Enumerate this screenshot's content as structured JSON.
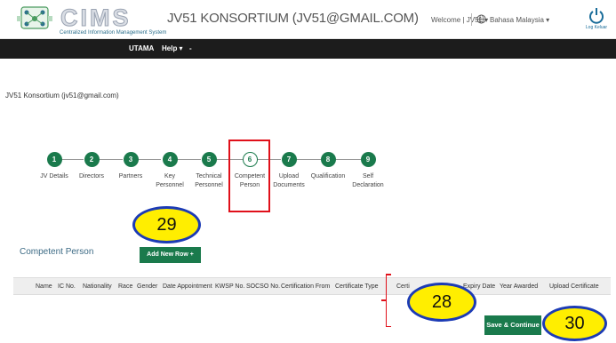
{
  "header": {
    "logo_text": "CIMS",
    "logo_subtitle": "Centralized Information Management System",
    "title": "JV51 KONSORTIUM (JV51@GMAIL.COM)",
    "welcome": "Welcome | JV51 ▾",
    "language": "Bahasa Malaysia ▾",
    "logout_label": "Log Keluar"
  },
  "nav": {
    "items": [
      "UTAMA",
      "Help ▾",
      "-"
    ]
  },
  "company_line": "JV51 Konsortium (jv51@gmail.com)",
  "steps": [
    {
      "number": "1",
      "label": "JV Details"
    },
    {
      "number": "2",
      "label": "Directors"
    },
    {
      "number": "3",
      "label": "Partners"
    },
    {
      "number": "4",
      "label": "Key Personnel"
    },
    {
      "number": "5",
      "label": "Technical Personnel"
    },
    {
      "number": "6",
      "label": "Competent Person",
      "active": true
    },
    {
      "number": "7",
      "label": "Upload Documents"
    },
    {
      "number": "8",
      "label": "Qualification"
    },
    {
      "number": "9",
      "label": "Self Declaration"
    }
  ],
  "section": {
    "title": "Competent Person",
    "add_button": "Add New Row +"
  },
  "table": {
    "headers": [
      "Name",
      "IC No.",
      "Nationality",
      "Race",
      "Gender",
      "Date Appointment",
      "KWSP No.",
      "SOCSO No.",
      "Certification From",
      "Certificate Type",
      "Certi",
      "Expiry Date",
      "Year Awarded",
      "Upload Certificate"
    ]
  },
  "save_button": "Save & Continue",
  "callouts": [
    "29",
    "28",
    "30"
  ],
  "colors": {
    "primary_green": "#1a7a4c",
    "nav_bg": "#1c1c1c",
    "highlight_red": "#e0101a",
    "callout_fill": "#ffee00",
    "callout_border": "#1c3bb5"
  }
}
